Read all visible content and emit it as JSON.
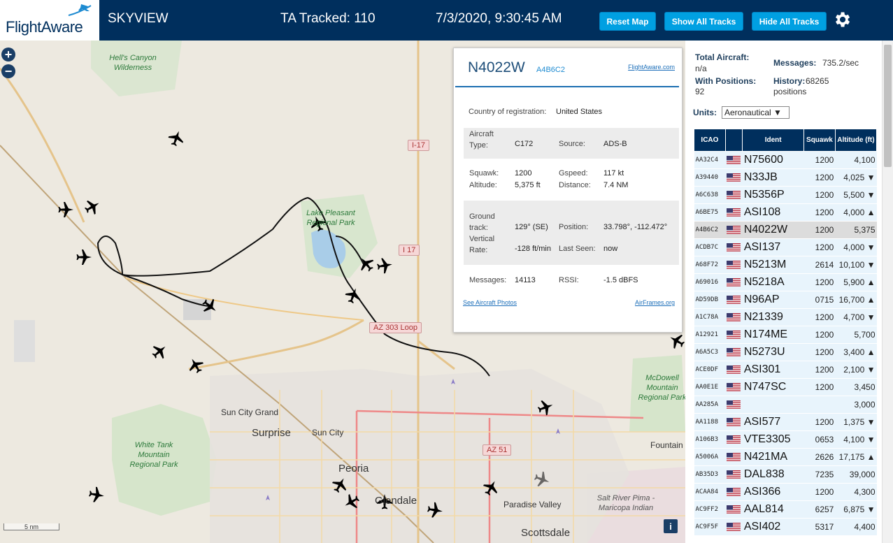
{
  "header": {
    "logo": "FlightAware",
    "app_name": "SKYVIEW",
    "tracked": "TA Tracked: 110",
    "datetime": "7/3/2020, 9:30:45 AM",
    "reset_map": "Reset Map",
    "show_all": "Show All Tracks",
    "hide_all": "Hide All Tracks",
    "colors": {
      "header_bg": "#002f5d",
      "button_bg": "#00a0e2"
    }
  },
  "map": {
    "zoom_in": "+",
    "zoom_out": "−",
    "scale": "5 nm",
    "info": "i",
    "places": [
      "Sun City Grand",
      "Surprise",
      "Sun City",
      "Peoria",
      "Glendale",
      "Scottsdale",
      "Paradise Valley",
      "Fountain"
    ],
    "parks": {
      "lake_pleasant": "Lake Pleasant Regional Park",
      "white_tank": "White Tank Mountain Regional Park",
      "mcdowell": "McDowell Mountain Regional Park",
      "salt_river": "Salt River Pima - Maricopa Indian",
      "wilderness": "Hell's Canyon Wilderness"
    },
    "highways": {
      "i17_a": "I-17",
      "i17_b": "I 17",
      "az303": "AZ 303 Loop",
      "az51": "AZ 51"
    }
  },
  "popup": {
    "flight": "N4022W",
    "hex": "A4B6C2",
    "fa_link": "FlightAware.com",
    "country_label": "Country of registration:",
    "country": "United States",
    "aircraft_type_label": "Aircraft Type:",
    "aircraft_type": "C172",
    "source_label": "Source:",
    "source": "ADS-B",
    "squawk_label": "Squawk:",
    "squawk": "1200",
    "gspeed_label": "Gspeed:",
    "gspeed": "117 kt",
    "altitude_label": "Altitude:",
    "altitude": "5,375 ft",
    "distance_label": "Distance:",
    "distance": "7.4 NM",
    "ground_track_label": "Ground track:",
    "ground_track": "129° (SE)",
    "position_label": "Position:",
    "position": "33.798°, -112.472°",
    "vertical_rate_label": "Vertical Rate:",
    "vertical_rate": "-128 ft/min",
    "last_seen_label": "Last Seen:",
    "last_seen": "now",
    "messages_label": "Messages:",
    "messages": "14113",
    "rssi_label": "RSSI:",
    "rssi": "-1.5 dBFS",
    "photos_link": "See Aircraft Photos",
    "airframes_link": "AirFrames.org"
  },
  "side": {
    "total_aircraft_label": "Total Aircraft:",
    "total_aircraft": "n/a",
    "messages_label": "Messages:",
    "messages": "735.2/sec",
    "with_positions_label": "With Positions:",
    "with_positions": "92",
    "history_label": "History:",
    "history": "68265 positions",
    "units_label": "Units:",
    "units_value": "Aeronautical ▼",
    "columns": [
      "ICAO",
      "",
      "Ident",
      "Squawk",
      "Altitude (ft)"
    ],
    "rows": [
      {
        "icao": "AA32C4",
        "ident": "N75600",
        "squawk": "1200",
        "alt": "4,100"
      },
      {
        "icao": "A39440",
        "ident": "N33JB",
        "squawk": "1200",
        "alt": "4,025 ▼"
      },
      {
        "icao": "A6C638",
        "ident": "N5356P",
        "squawk": "1200",
        "alt": "5,500 ▼"
      },
      {
        "icao": "A6BE75",
        "ident": "ASI108",
        "squawk": "1200",
        "alt": "4,000 ▲"
      },
      {
        "icao": "A4B6C2",
        "ident": "N4022W",
        "squawk": "1200",
        "alt": "5,375"
      },
      {
        "icao": "ACDB7C",
        "ident": "ASI137",
        "squawk": "1200",
        "alt": "4,000 ▼"
      },
      {
        "icao": "A68F72",
        "ident": "N5213M",
        "squawk": "2614",
        "alt": "10,100 ▼"
      },
      {
        "icao": "A69016",
        "ident": "N5218A",
        "squawk": "1200",
        "alt": "5,900 ▲"
      },
      {
        "icao": "AD59DB",
        "ident": "N96AP",
        "squawk": "0715",
        "alt": "16,700 ▲"
      },
      {
        "icao": "A1C78A",
        "ident": "N21339",
        "squawk": "1200",
        "alt": "4,700 ▼"
      },
      {
        "icao": "A12921",
        "ident": "N174ME",
        "squawk": "1200",
        "alt": "5,700"
      },
      {
        "icao": "A6A5C3",
        "ident": "N5273U",
        "squawk": "1200",
        "alt": "3,400 ▲"
      },
      {
        "icao": "ACE0DF",
        "ident": "ASI301",
        "squawk": "1200",
        "alt": "2,100 ▼"
      },
      {
        "icao": "AA0E1E",
        "ident": "N747SC",
        "squawk": "1200",
        "alt": "3,450"
      },
      {
        "icao": "AA285A",
        "ident": "",
        "squawk": "",
        "alt": "3,000"
      },
      {
        "icao": "AA1188",
        "ident": "ASI577",
        "squawk": "1200",
        "alt": "1,375 ▼"
      },
      {
        "icao": "A106B3",
        "ident": "VTE3305",
        "squawk": "0653",
        "alt": "4,100 ▼"
      },
      {
        "icao": "A5006A",
        "ident": "N421MA",
        "squawk": "2626",
        "alt": "17,175 ▲"
      },
      {
        "icao": "AB35D3",
        "ident": "DAL838",
        "squawk": "7235",
        "alt": "39,000"
      },
      {
        "icao": "ACAA84",
        "ident": "ASI366",
        "squawk": "1200",
        "alt": "4,300"
      },
      {
        "icao": "AC9FF2",
        "ident": "AAL814",
        "squawk": "6257",
        "alt": "6,875 ▼"
      },
      {
        "icao": "AC9F5F",
        "ident": "ASI402",
        "squawk": "5317",
        "alt": "4,400"
      }
    ],
    "selected_icao": "A4B6C2"
  }
}
